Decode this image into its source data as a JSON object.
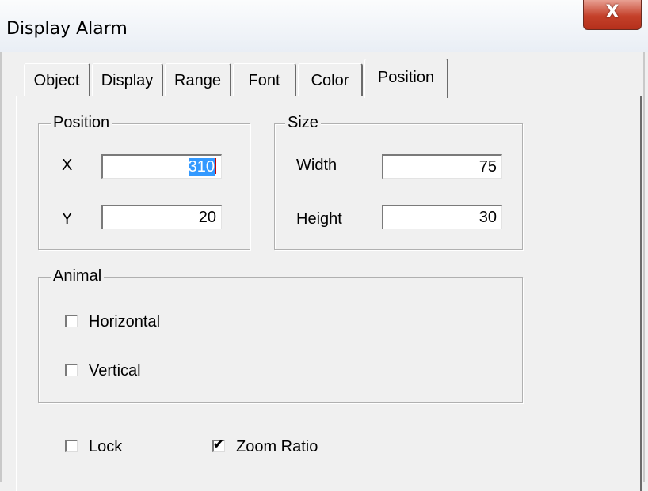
{
  "window": {
    "title": "Display Alarm",
    "close_glyph": "X"
  },
  "tabs": [
    {
      "label": "Object"
    },
    {
      "label": "Display"
    },
    {
      "label": "Range"
    },
    {
      "label": "Font"
    },
    {
      "label": "Color"
    },
    {
      "label": "Position",
      "active": true
    }
  ],
  "position_group": {
    "label": "Position",
    "x_label": "X",
    "x_value": "310",
    "y_label": "Y",
    "y_value": "20"
  },
  "size_group": {
    "label": "Size",
    "width_label": "Width",
    "width_value": "75",
    "height_label": "Height",
    "height_value": "30"
  },
  "animal_group": {
    "label": "Animal",
    "horizontal_label": "Horizontal",
    "horizontal_checked": false,
    "vertical_label": "Vertical",
    "vertical_checked": false
  },
  "options": {
    "lock_label": "Lock",
    "lock_checked": false,
    "zoom_label": "Zoom Ratio",
    "zoom_checked": true
  }
}
